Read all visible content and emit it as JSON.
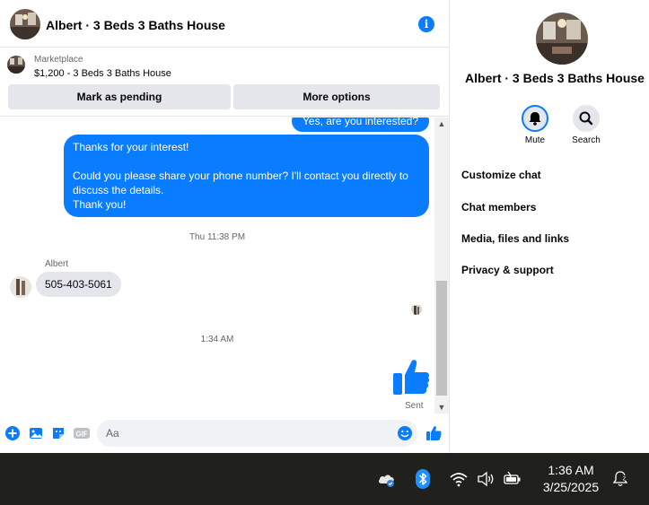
{
  "header": {
    "title": "Albert · 3 Beds 3 Baths House",
    "info_icon": "info-icon"
  },
  "marketplace": {
    "label": "Marketplace",
    "listing": "$1,200 - 3 Beds 3 Baths House",
    "pending_label": "Mark as pending",
    "more_label": "More options"
  },
  "messages": {
    "out1": "Yes, are you interested?",
    "out2": "Thanks for your interest!\n\nCould you please share your phone number? I'll contact you directly to discuss the details.\nThank you!",
    "ts1": "Thu 11:38 PM",
    "sender": "Albert",
    "in1": "505-403-5061",
    "ts2": "1:34 AM",
    "status": "Sent"
  },
  "composer": {
    "placeholder": "Aa"
  },
  "side": {
    "title": "Albert · 3 Beds 3 Baths House",
    "mute_label": "Mute",
    "search_label": "Search",
    "menu": [
      "Customize chat",
      "Chat members",
      "Media, files and links",
      "Privacy & support"
    ]
  },
  "taskbar": {
    "time": "1:36 AM",
    "date": "3/25/2025"
  },
  "colors": {
    "accent": "#0a7cff",
    "bubble_in": "#e4e6eb",
    "taskbar": "#20201c"
  }
}
